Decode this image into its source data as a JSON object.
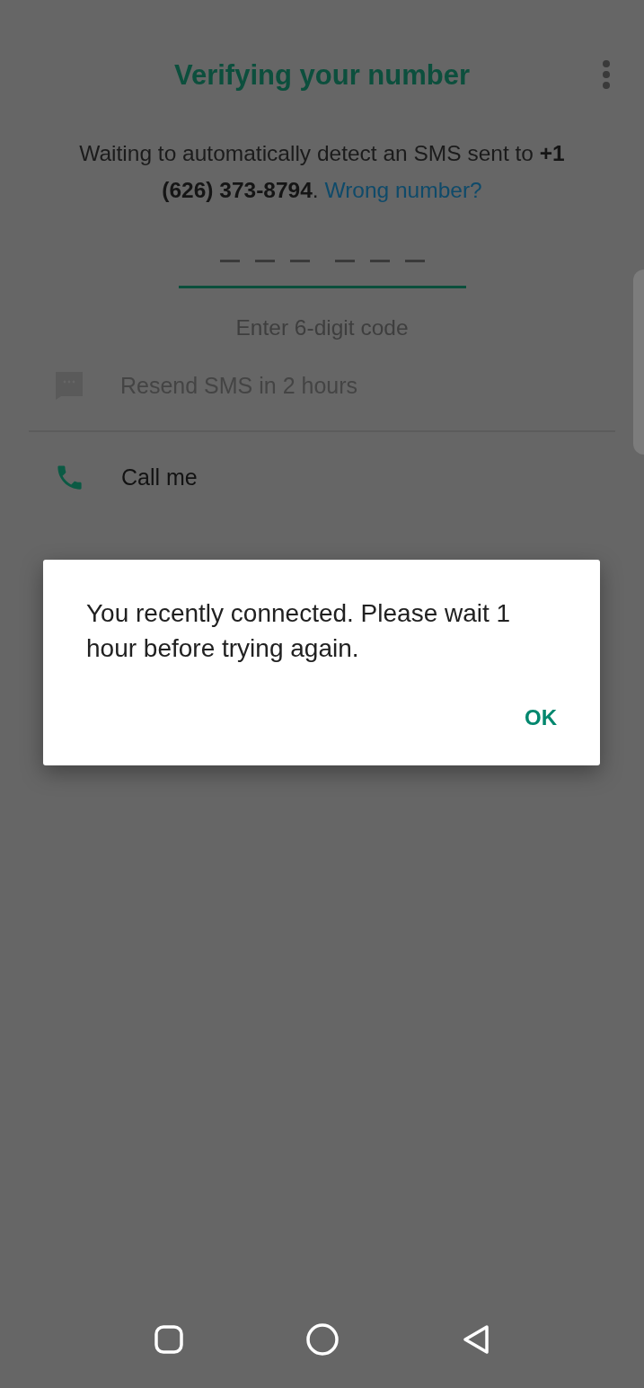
{
  "header": {
    "title": "Verifying your number"
  },
  "message": {
    "text": "Waiting to automatically detect an SMS sent to **+1 (626) 373-8794**.",
    "link": "Wrong number?"
  },
  "code_field": {
    "placeholder": "Enter 6-digit code"
  },
  "options": [
    {
      "kind": "sms",
      "label": "Resend SMS in 2 hours",
      "disabled": true
    },
    {
      "kind": "call",
      "label": "Call me",
      "disabled": false
    }
  ],
  "dialog": {
    "message": "You recently connected. Please wait 1 hour before trying again.",
    "button": "OK"
  }
}
